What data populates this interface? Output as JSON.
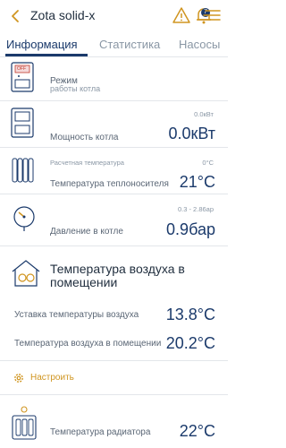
{
  "header": {
    "title": "Zota solid-x",
    "notif_count": "7"
  },
  "tabs": [
    {
      "label": "Информация",
      "active": true
    },
    {
      "label": "Статистика",
      "active": false
    },
    {
      "label": "Насосы",
      "active": false
    }
  ],
  "rows": {
    "mode": {
      "label_line1": "Режим",
      "label_line2": "работы котла",
      "icon_text": "OFF"
    },
    "power": {
      "label": "Мощность котла",
      "range": "0.0кВт",
      "value": "0.0кВт"
    },
    "coolant": {
      "label_top": "Расчетная температура",
      "range": "0°C",
      "label": "Температура теплоносителя",
      "value": "21°C"
    },
    "pressure": {
      "range": "0.3 - 2.86ар",
      "label": "Давление в котле",
      "value": "0.9бар"
    }
  },
  "air": {
    "title": "Температура воздуха в помещении",
    "setpoint_label": "Уставка температуры воздуха",
    "setpoint_value": "13.8°C",
    "room_label": "Температура воздуха в помещении",
    "room_value": "20.2°C"
  },
  "setup": {
    "label": "Настроить"
  },
  "radiator": {
    "label": "Температура радиатора",
    "value": "22°C"
  },
  "colors": {
    "accent": "#1b3a6b",
    "warning": "#d09520",
    "muted": "#8a97a5"
  }
}
